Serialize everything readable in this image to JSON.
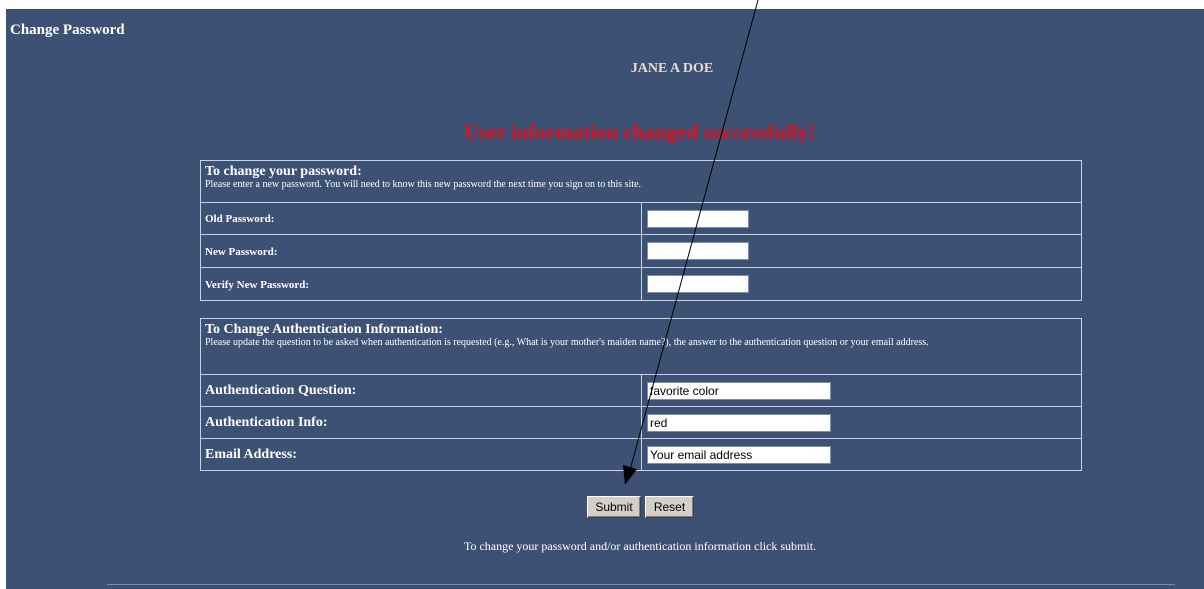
{
  "page": {
    "title": "Change Password"
  },
  "user": {
    "name": "JANE A DOE"
  },
  "status": {
    "message": "User information changed successfully!",
    "color": "#e0101e"
  },
  "password_section": {
    "heading": "To change your password:",
    "description": "Please enter a new password. You will need to know this new password the next time you sign on to this site.",
    "fields": [
      {
        "label": "Old Password:",
        "value": ""
      },
      {
        "label": "New Password:",
        "value": ""
      },
      {
        "label": "Verify New Password:",
        "value": ""
      }
    ]
  },
  "auth_section": {
    "heading": "To Change Authentication Information:",
    "description": "Please update the question to be asked when authentication is requested (e.g., What is your mother's maiden name?), the answer to the authentication question or your email address.",
    "fields": [
      {
        "label": "Authentication Question:",
        "value": "favorite color"
      },
      {
        "label": "Authentication Info:",
        "value": "red"
      },
      {
        "label": "Email Address:",
        "value": "Your email address"
      }
    ]
  },
  "buttons": {
    "submit": "Submit",
    "reset": "Reset"
  },
  "footer": {
    "note": "To change your password and/or authentication information click submit."
  },
  "colors": {
    "background": "#3d5175",
    "accent_name": "#e6dccf",
    "border": "#c9d2e2"
  },
  "annotation": {
    "icon": "arrow-pointer-icon"
  }
}
